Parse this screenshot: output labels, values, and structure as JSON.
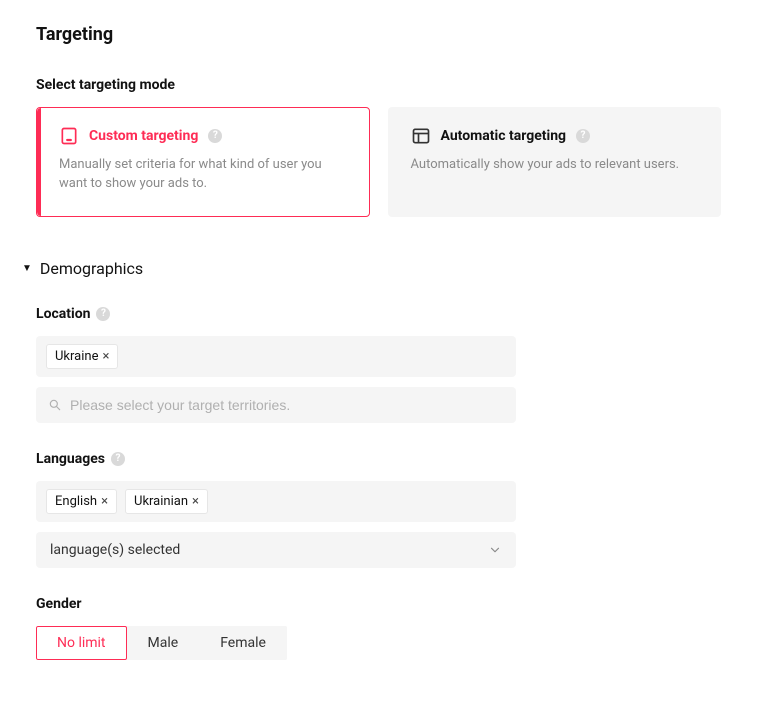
{
  "page": {
    "title": "Targeting"
  },
  "mode": {
    "heading": "Select targeting mode",
    "options": [
      {
        "title": "Custom targeting",
        "desc": "Manually set criteria for what kind of user you want to show your ads to.",
        "selected": true
      },
      {
        "title": "Automatic targeting",
        "desc": "Automatically show your ads to relevant users.",
        "selected": false
      }
    ]
  },
  "demographics": {
    "label": "Demographics",
    "expanded": true,
    "location": {
      "label": "Location",
      "chips": [
        "Ukraine"
      ],
      "search_placeholder": "Please select your target territories."
    },
    "languages": {
      "label": "Languages",
      "chips": [
        "English",
        "Ukrainian"
      ],
      "select_text": "language(s) selected"
    },
    "gender": {
      "label": "Gender",
      "options": [
        "No limit",
        "Male",
        "Female"
      ],
      "selected_index": 0
    }
  }
}
